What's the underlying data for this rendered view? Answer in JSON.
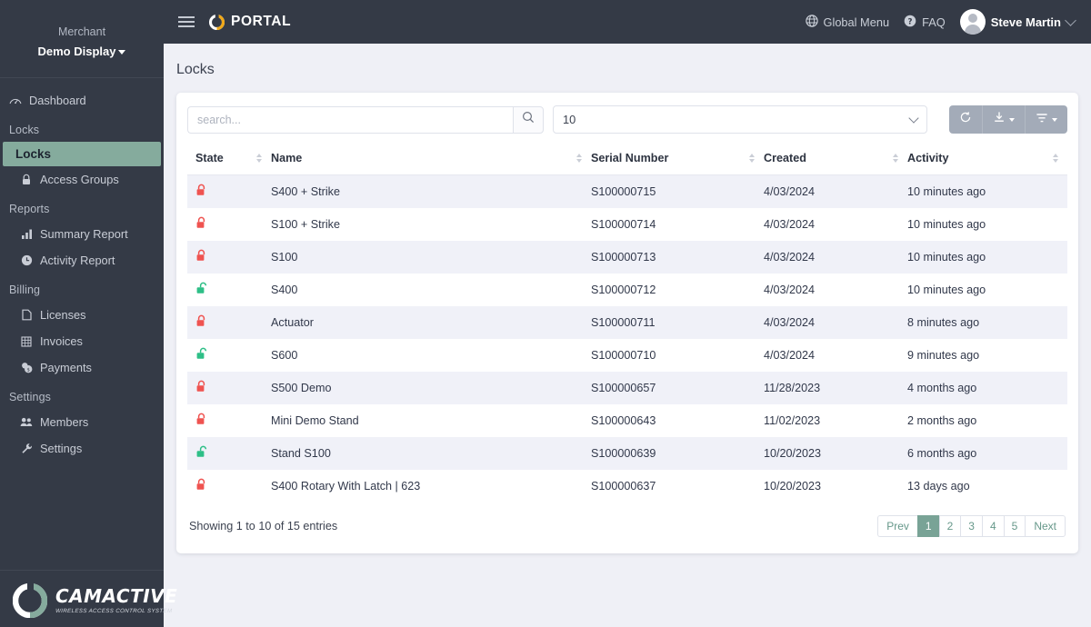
{
  "sidebar": {
    "merchant_label": "Merchant",
    "merchant_name": "Demo Display",
    "dashboard": {
      "label": "Dashboard",
      "icon": "gauge-icon"
    },
    "sections": [
      {
        "title": "Locks",
        "items": [
          {
            "label": "Locks",
            "icon": "none",
            "active": true
          },
          {
            "label": "Access Groups",
            "icon": "lock-icon",
            "active": false
          }
        ]
      },
      {
        "title": "Reports",
        "items": [
          {
            "label": "Summary Report",
            "icon": "bar-chart-icon",
            "active": false
          },
          {
            "label": "Activity Report",
            "icon": "clock-icon",
            "active": false
          }
        ]
      },
      {
        "title": "Billing",
        "items": [
          {
            "label": "Licenses",
            "icon": "document-icon",
            "active": false
          },
          {
            "label": "Invoices",
            "icon": "table-icon",
            "active": false
          },
          {
            "label": "Payments",
            "icon": "coins-icon",
            "active": false
          }
        ]
      },
      {
        "title": "Settings",
        "items": [
          {
            "label": "Members",
            "icon": "users-icon",
            "active": false
          },
          {
            "label": "Settings",
            "icon": "wrench-icon",
            "active": false
          }
        ]
      }
    ],
    "logo": {
      "name": "CAMACTIVE",
      "tagline": "WIRELESS ACCESS CONTROL SYSTEM"
    }
  },
  "topbar": {
    "menu_icon": "hamburger-icon",
    "brand": "PORTAL",
    "global_menu": "Global Menu",
    "faq": "FAQ",
    "user": "Steve Martin"
  },
  "page": {
    "title": "Locks"
  },
  "toolbar": {
    "search_placeholder": "search...",
    "search_value": "",
    "page_size": "10",
    "refresh_label": "refresh-icon",
    "export_label": "download-icon",
    "filter_label": "filter-icon"
  },
  "table": {
    "columns": [
      "State",
      "Name",
      "Serial Number",
      "Created",
      "Activity"
    ],
    "rows": [
      {
        "state": "locked",
        "name": "S400 + Strike",
        "serial": "S100000715",
        "created": "4/03/2024",
        "activity": "10 minutes ago"
      },
      {
        "state": "locked",
        "name": "S100 + Strike",
        "serial": "S100000714",
        "created": "4/03/2024",
        "activity": "10 minutes ago"
      },
      {
        "state": "locked",
        "name": "S100",
        "serial": "S100000713",
        "created": "4/03/2024",
        "activity": "10 minutes ago"
      },
      {
        "state": "unlocked",
        "name": "S400",
        "serial": "S100000712",
        "created": "4/03/2024",
        "activity": "10 minutes ago"
      },
      {
        "state": "locked",
        "name": "Actuator",
        "serial": "S100000711",
        "created": "4/03/2024",
        "activity": "8 minutes ago"
      },
      {
        "state": "unlocked",
        "name": "S600",
        "serial": "S100000710",
        "created": "4/03/2024",
        "activity": "9 minutes ago"
      },
      {
        "state": "locked",
        "name": "S500 Demo",
        "serial": "S100000657",
        "created": "11/28/2023",
        "activity": "4 months ago"
      },
      {
        "state": "locked",
        "name": "Mini Demo Stand",
        "serial": "S100000643",
        "created": "11/02/2023",
        "activity": "2 months ago"
      },
      {
        "state": "unlocked",
        "name": "Stand S100",
        "serial": "S100000639",
        "created": "10/20/2023",
        "activity": "6 months ago"
      },
      {
        "state": "locked",
        "name": "S400 Rotary With Latch | 623",
        "serial": "S100000637",
        "created": "10/20/2023",
        "activity": "13 days ago"
      }
    ]
  },
  "footer": {
    "entries_text": "Showing 1 to 10 of 15 entries",
    "pages": [
      "Prev",
      "1",
      "2",
      "3",
      "4",
      "5",
      "Next"
    ],
    "active_page": "1"
  },
  "colors": {
    "sidebar_bg": "#343a46",
    "accent_green": "#85ab9d",
    "pager_green": "#79a396",
    "locked_red": "#ef5350",
    "unlocked_green": "#2ebf87",
    "portal_gold": "#f0a818",
    "page_bg": "#eff0f6",
    "row_stripe": "#f0f1f8"
  }
}
